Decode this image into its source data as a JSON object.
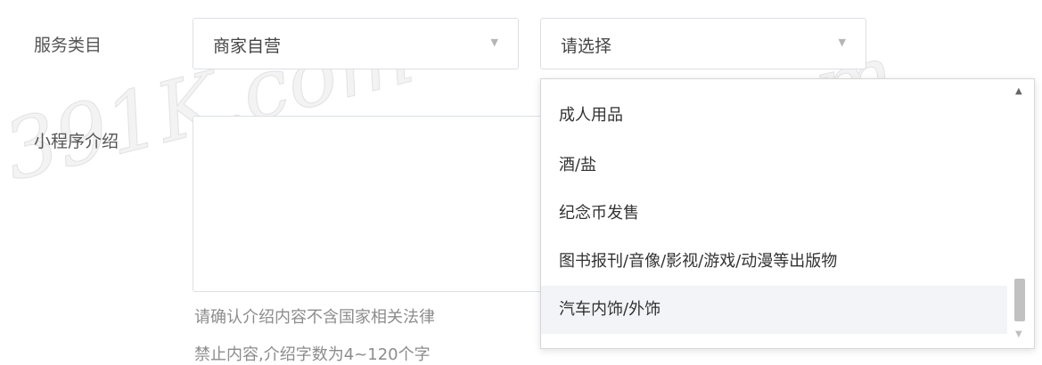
{
  "form": {
    "service_category_label": "服务类目",
    "intro_label": "小程序介绍",
    "primary_select_value": "商家自营",
    "secondary_select_value": "请选择",
    "intro_hint_line1": "请确认介绍内容不含国家相关法律",
    "intro_hint_line2": "禁止内容,介绍字数为4~120个字"
  },
  "dropdown": {
    "options": [
      "成人用品",
      "酒/盐",
      "纪念币发售",
      "图书报刊/音像/影视/游戏/动漫等出版物",
      "汽车内饰/外饰"
    ],
    "hovered_index": 4
  },
  "icons": {
    "select_arrow": "chevron-down-icon",
    "scroll_up": "scroll-up-icon",
    "scroll_down": "scroll-down-icon"
  },
  "watermark": "391K.com",
  "colors": {
    "border": "#dcdfe6",
    "hover_bg": "#f2f4f7",
    "hint_text": "#8c8c8c"
  }
}
